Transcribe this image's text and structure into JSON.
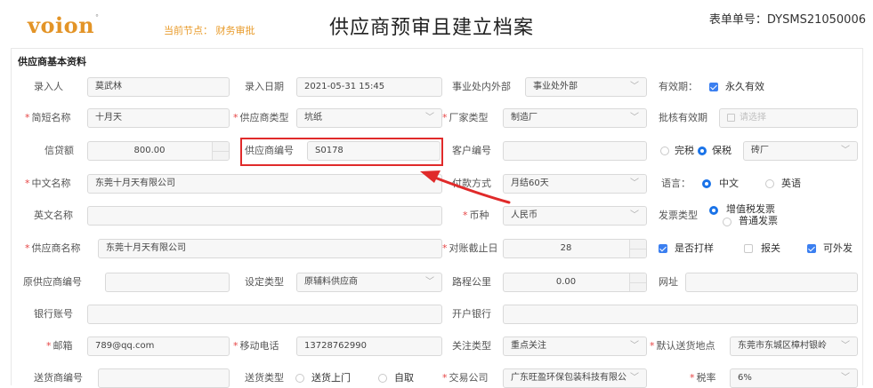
{
  "header": {
    "logo_text": "voion",
    "logo_mark": "°",
    "current_node": "当前节点： 财务审批",
    "title": "供应商预审且建立档案",
    "form_no": "表单单号：DYSMS21050006"
  },
  "section_title": "供应商基本资料",
  "row1": {
    "entered_by_label": "录入人",
    "entered_by": "莫武林",
    "entry_date_label": "录入日期",
    "entry_date": "2021-05-31 15:45",
    "division_label": "事业处内外部",
    "division": "事业处外部",
    "validity_label": "有效期：",
    "validity_option": "永久有效"
  },
  "row2": {
    "short_name_label": "简短名称",
    "short_name": "十月天",
    "supplier_type_label": "供应商类型",
    "supplier_type": "坑纸",
    "factory_type_label": "厂家类型",
    "factory_type": "制造厂",
    "approval_validity_label": "批核有效期",
    "approval_validity_placeholder": "请选择"
  },
  "row3": {
    "credit_label": "信贷额",
    "credit": "800.00",
    "supplier_code_label": "供应商编号",
    "supplier_code": "S0178",
    "customer_code_label": "客户编号",
    "customer_code": "",
    "tax_option_1": "完税",
    "tax_option_2": "保税",
    "tax_select": "砖厂"
  },
  "row4": {
    "cn_name_label": "中文名称",
    "cn_name": "东莞十月天有限公司",
    "payment_label": "付款方式",
    "payment": "月结60天",
    "language_label": "语言：",
    "lang_cn": "中文",
    "lang_en": "英语"
  },
  "row5": {
    "en_name_label": "英文名称",
    "en_name": "",
    "currency_label": "币种",
    "currency": "人民币",
    "invoice_label": "发票类型",
    "invoice_vat": "增值税发票",
    "invoice_normal": "普通发票"
  },
  "row6": {
    "supplier_name_label": "供应商名称",
    "supplier_name": "东莞十月天有限公司",
    "cutoff_label": "对账截止日",
    "cutoff": "28",
    "sample_label": "是否打样",
    "customs_label": "报关",
    "export_label": "可外发"
  },
  "row7": {
    "orig_code_label": "原供应商编号",
    "orig_code": "",
    "set_type_label": "设定类型",
    "set_type": "原辅料供应商",
    "distance_label": "路程公里",
    "distance": "0.00",
    "website_label": "网址",
    "website": ""
  },
  "row8": {
    "bank_account_label": "银行账号",
    "bank_account": "",
    "bank_label": "开户银行",
    "bank": ""
  },
  "row9": {
    "email_label": "邮箱",
    "email": "789@qq.com",
    "mobile_label": "移动电话",
    "mobile": "13728762990",
    "attention_label": "关注类型",
    "attention": "重点关注",
    "delivery_place_label": "默认送货地点",
    "delivery_place": "东莞市东城区樟村银岭"
  },
  "row10": {
    "delivery_code_label": "送货商编号",
    "delivery_code": "",
    "delivery_type_label": "送货类型",
    "delivery_opt_1": "送货上门",
    "delivery_opt_2": "自取",
    "trading_company_label": "交易公司",
    "trading_company": "广东旺盈环保包装科技有限公",
    "tax_rate_label": "税率",
    "tax_rate": "6%"
  },
  "colors": {
    "required": "#e64545",
    "highlight": "#e02a2a",
    "accent": "#1a73e8",
    "logo": "#e39427",
    "node": "#e89b2a"
  }
}
